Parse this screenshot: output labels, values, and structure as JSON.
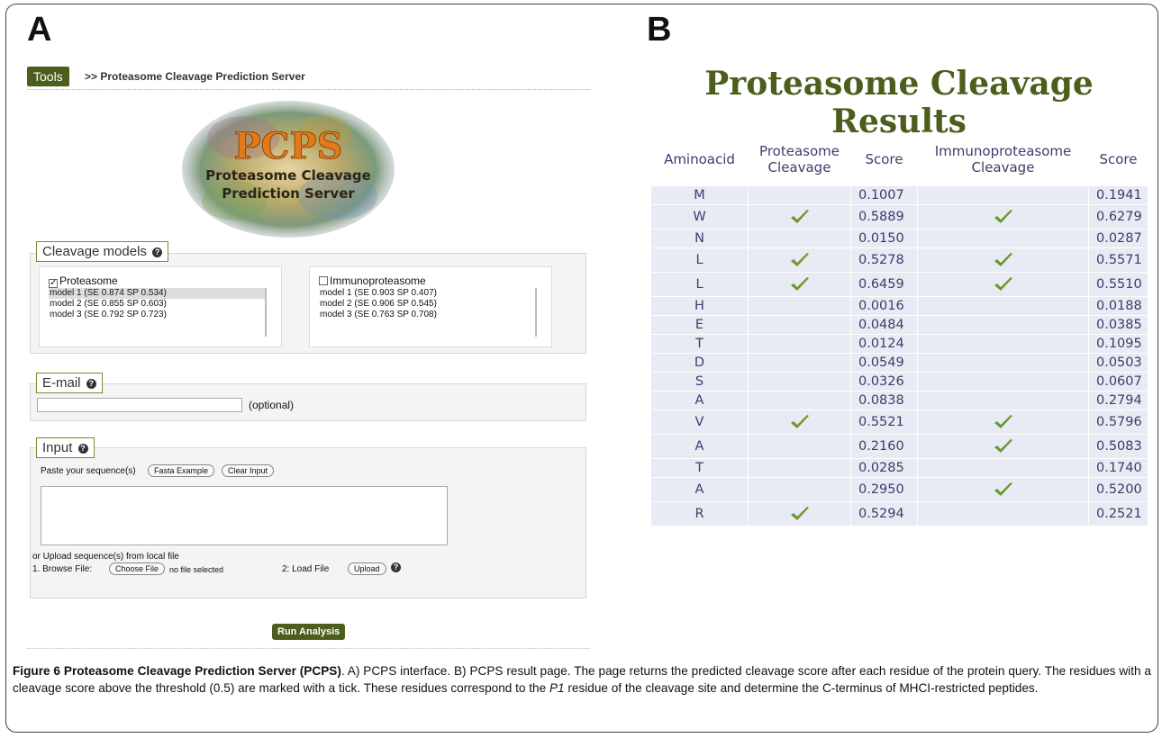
{
  "panels": {
    "a": "A",
    "b": "B"
  },
  "tools": {
    "button": "Tools",
    "breadcrumb": ">> Proteasome Cleavage Prediction Server"
  },
  "logo": {
    "acronym": "PCPS",
    "line1": "Proteasome Cleavage",
    "line2": "Prediction Server"
  },
  "cleavage_models": {
    "legend": "Cleavage models",
    "proteasome": {
      "label": "Proteasome",
      "checked": true,
      "models": [
        "model 1 (SE 0.874 SP 0.534)",
        "model 2 (SE 0.855 SP 0.603)",
        "model 3 (SE 0.792 SP 0.723)"
      ],
      "selected_index": 0
    },
    "immunoproteasome": {
      "label": "Immunoproteasome",
      "checked": false,
      "models": [
        "model 1 (SE 0.903 SP 0.407)",
        "model 2 (SE 0.906 SP 0.545)",
        "model 3 (SE 0.763 SP 0.708)"
      ]
    }
  },
  "email": {
    "legend": "E-mail",
    "value": "",
    "optional_label": "(optional)"
  },
  "input": {
    "legend": "Input",
    "paste_label": "Paste your sequence(s)",
    "fasta_button": "Fasta Example",
    "clear_button": "Clear Input",
    "sequence_value": "",
    "upload_label": "or Upload sequence(s) from local file",
    "browse_label": "1. Browse File:",
    "choose_button": "Choose File",
    "no_file": "no file selected",
    "load_label": "2: Load File",
    "upload_button": "Upload"
  },
  "run_button": "Run Analysis",
  "results": {
    "title": "Proteasome Cleavage Results",
    "headers": [
      "Aminoacid",
      "Proteasome Cleavage",
      "Score",
      "Immunoproteasome Cleavage",
      "Score"
    ],
    "rows": [
      {
        "aa": "M",
        "p_tick": false,
        "p_score": "0.1007",
        "i_tick": false,
        "i_score": "0.1941"
      },
      {
        "aa": "W",
        "p_tick": true,
        "p_score": "0.5889",
        "i_tick": true,
        "i_score": "0.6279"
      },
      {
        "aa": "N",
        "p_tick": false,
        "p_score": "0.0150",
        "i_tick": false,
        "i_score": "0.0287"
      },
      {
        "aa": "L",
        "p_tick": true,
        "p_score": "0.5278",
        "i_tick": true,
        "i_score": "0.5571"
      },
      {
        "aa": "L",
        "p_tick": true,
        "p_score": "0.6459",
        "i_tick": true,
        "i_score": "0.5510"
      },
      {
        "aa": "H",
        "p_tick": false,
        "p_score": "0.0016",
        "i_tick": false,
        "i_score": "0.0188"
      },
      {
        "aa": "E",
        "p_tick": false,
        "p_score": "0.0484",
        "i_tick": false,
        "i_score": "0.0385"
      },
      {
        "aa": "T",
        "p_tick": false,
        "p_score": "0.0124",
        "i_tick": false,
        "i_score": "0.1095"
      },
      {
        "aa": "D",
        "p_tick": false,
        "p_score": "0.0549",
        "i_tick": false,
        "i_score": "0.0503"
      },
      {
        "aa": "S",
        "p_tick": false,
        "p_score": "0.0326",
        "i_tick": false,
        "i_score": "0.0607"
      },
      {
        "aa": "A",
        "p_tick": false,
        "p_score": "0.0838",
        "i_tick": false,
        "i_score": "0.2794"
      },
      {
        "aa": "V",
        "p_tick": true,
        "p_score": "0.5521",
        "i_tick": true,
        "i_score": "0.5796"
      },
      {
        "aa": "A",
        "p_tick": false,
        "p_score": "0.2160",
        "i_tick": true,
        "i_score": "0.5083"
      },
      {
        "aa": "T",
        "p_tick": false,
        "p_score": "0.0285",
        "i_tick": false,
        "i_score": "0.1740"
      },
      {
        "aa": "A",
        "p_tick": false,
        "p_score": "0.2950",
        "i_tick": true,
        "i_score": "0.5200"
      },
      {
        "aa": "R",
        "p_tick": true,
        "p_score": "0.5294",
        "i_tick": false,
        "i_score": "0.2521"
      }
    ]
  },
  "caption": {
    "label": "Figure 6 Proteasome Cleavage Prediction Server (PCPS)",
    "text_1": ". A) PCPS interface. B) PCPS result page. The page returns the predicted cleavage score after each residue of the protein query. The residues with a cleavage score above the threshold (0.5) are marked with a tick. These residues correspond to the ",
    "italic": "P1",
    "text_2": " residue of the cleavage site and determine the C-terminus of MHCI-restricted peptides."
  },
  "colors": {
    "accent_green": "#4b5e1c",
    "tick_green": "#6a9a2a",
    "table_text": "#3a3e6a",
    "table_cell": "#e8eaf4"
  },
  "icons": {
    "help": "help-circle-icon",
    "tick": "check-mark-icon"
  }
}
